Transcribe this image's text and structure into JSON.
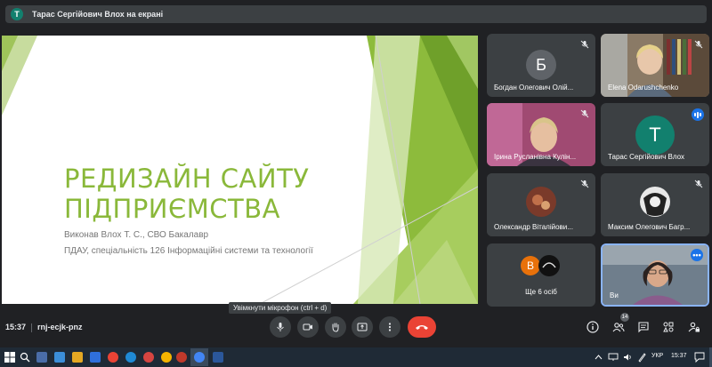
{
  "presenter_bar": {
    "avatar_letter": "Т",
    "title": "Тарас Сергійович Влох на екрані"
  },
  "slide": {
    "headline_line1": "РЕДИЗАЙН САЙТУ",
    "headline_line2": "ПІДПРИЄМСТВА",
    "author_line": "Виконав Влох Т. С., СВО Бакалавр",
    "institution_line": "ПДАУ, спеціальність 126 Інформаційні системи та технології",
    "accent_color": "#8ab83a"
  },
  "participants": [
    {
      "name": "Богдан Олегович Олій...",
      "avatar_letter": "Б",
      "avatar_color": "#5f6368"
    },
    {
      "name": "Elena Odarushchenko"
    },
    {
      "name": "Ірина Русланівна Кулін..."
    },
    {
      "name": "Тарас Сергійович Влох",
      "avatar_letter": "Т",
      "avatar_color": "#12806e"
    },
    {
      "name": "Олександр Віталійови..."
    },
    {
      "name": "Максим Олегович Багр..."
    },
    {
      "name": "Ще 6 осіб",
      "avatar_letter": "В",
      "avatar_color": "#e8710a"
    },
    {
      "name": "Ви"
    }
  ],
  "tooltip": "Увімкнути мікрофон (ctrl + d)",
  "controls": {
    "time": "15:37",
    "meeting_code": "rnj-ecjk-pnz",
    "people_count": "14"
  },
  "taskbar": {
    "lang": "УКР",
    "time": "15:37"
  }
}
